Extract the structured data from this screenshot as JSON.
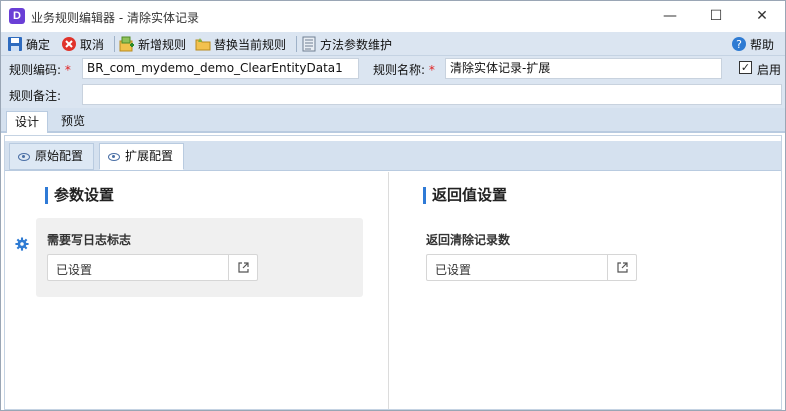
{
  "window": {
    "title": "业务规则编辑器 - 清除实体记录",
    "icon_letter": "D",
    "minimize": "—",
    "maximize": "☐",
    "close": "✕"
  },
  "toolbar": {
    "ok_label": "确定",
    "cancel_label": "取消",
    "new_rule_label": "新增规则",
    "replace_rule_label": "替换当前规则",
    "method_params_label": "方法参数维护",
    "help_label": "帮助"
  },
  "fields": {
    "rule_code_label": "规则编码:",
    "rule_code_value": "BR_com_mydemo_demo_ClearEntityData1",
    "rule_name_label": "规则名称:",
    "rule_name_value": "清除实体记录-扩展",
    "enable_label": "启用",
    "enable_checked": true,
    "rule_remark_label": "规则备注:",
    "rule_remark_value": "",
    "required_mark": "*"
  },
  "tabs": [
    {
      "label": "设计",
      "active": true
    },
    {
      "label": "预览",
      "active": false
    }
  ],
  "subtabs": [
    {
      "label": "原始配置",
      "active": false
    },
    {
      "label": "扩展配置",
      "active": true
    }
  ],
  "params": {
    "section_title": "参数设置",
    "field_label": "需要写日志标志",
    "field_value": "已设置"
  },
  "returns": {
    "section_title": "返回值设置",
    "field_label": "返回清除记录数",
    "field_value": "已设置"
  },
  "colors": {
    "toolbar_bg": "#dbe5f1",
    "accent": "#2f7ad6",
    "required": "#e02020"
  }
}
